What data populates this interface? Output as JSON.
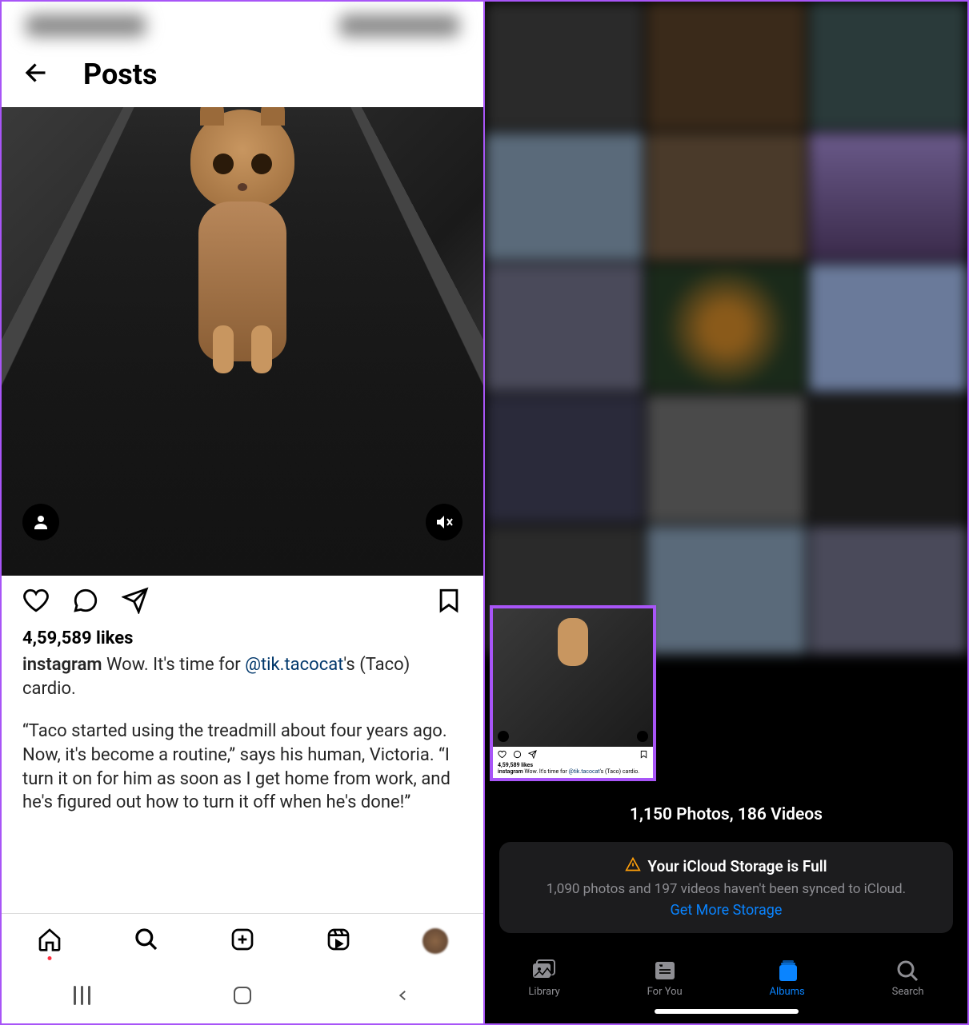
{
  "left": {
    "header_title": "Posts",
    "likes": "4,59,589 likes",
    "caption_user": "instagram",
    "caption_text1a": " Wow. It's time for ",
    "caption_mention": "@tik.tacocat",
    "caption_text1b": "'s (Taco) cardio.",
    "caption_text2": "“Taco started using the treadmill about four years ago. Now, it's become a routine,” says his human, Victoria. “I turn it on for him as soon as I get home from work, and he's figured out how to turn it off when he's done!”"
  },
  "right": {
    "summary": "1,150 Photos, 186 Videos",
    "banner_title": "Your iCloud Storage is Full",
    "banner_sub": "1,090 photos and 197 videos haven't been synced to iCloud.",
    "banner_link": "Get More Storage",
    "tabs": {
      "library": "Library",
      "foryou": "For You",
      "albums": "Albums",
      "search": "Search"
    },
    "thumb": {
      "likes": "4,59,589 likes",
      "user": "instagram",
      "text_a": " Wow. It's time for ",
      "mention": "@tik.tacocat",
      "text_b": "'s (Taco) cardio."
    }
  }
}
